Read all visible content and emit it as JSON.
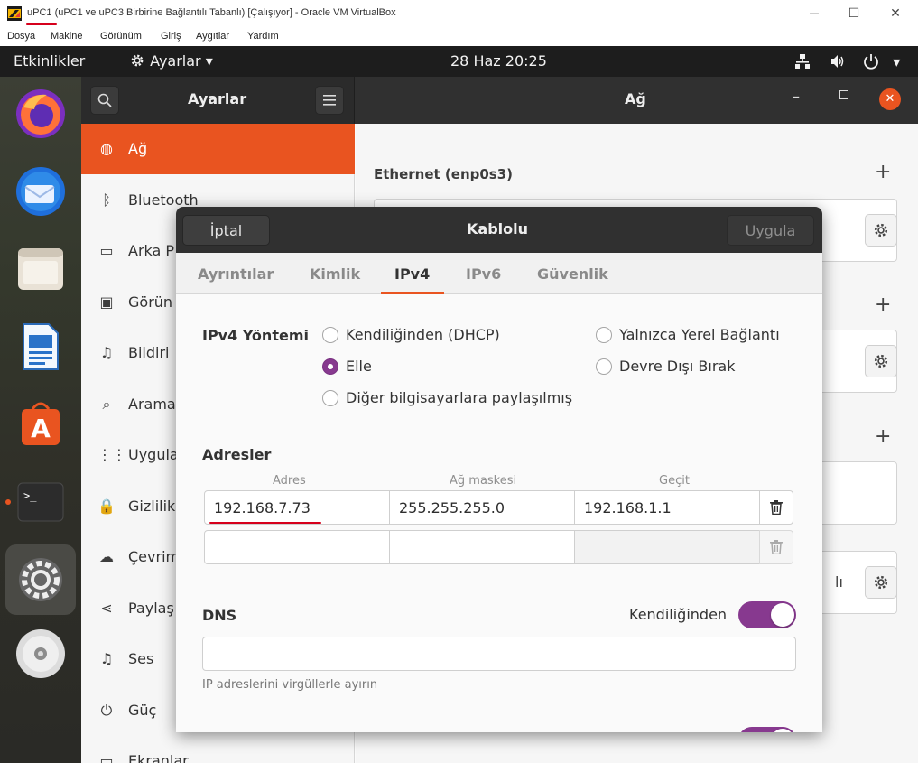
{
  "host": {
    "title": "uPC1 (uPC1 ve uPC3 Birbirine Bağlantılı Tabanlı) [Çalışıyor] - Oracle VM VirtualBox",
    "controls": {
      "minimize": "—",
      "maximize": "☐",
      "close": "✕"
    },
    "menu": [
      "Dosya",
      "Makine",
      "Görünüm",
      "Giriş",
      "Aygıtlar",
      "Yardım"
    ]
  },
  "topbar": {
    "activities": "Etkinlikler",
    "app_menu": "Ayarlar",
    "app_menu_arrow": "▾",
    "datetime": "28 Haz  20:25",
    "tray_arrow": "▾"
  },
  "settings": {
    "sidebar_title": "Ayarlar",
    "panel_title": "Ağ",
    "sidebar_items": [
      {
        "label": "Ağ",
        "icon": "globe-icon",
        "glyph": "◍"
      },
      {
        "label": "Bluetooth",
        "icon": "bluetooth-icon",
        "glyph": "ᛒ"
      },
      {
        "label": "Arka P",
        "icon": "background-icon",
        "glyph": "▭"
      },
      {
        "label": "Görün",
        "icon": "appearance-icon",
        "glyph": "▣"
      },
      {
        "label": "Bildiri",
        "icon": "bell-icon",
        "glyph": "♫"
      },
      {
        "label": "Arama",
        "icon": "search-icon",
        "glyph": "⌕"
      },
      {
        "label": "Uygula",
        "icon": "apps-grid-icon",
        "glyph": "⋮⋮"
      },
      {
        "label": "Gizlilik",
        "icon": "lock-icon",
        "glyph": "🔒"
      },
      {
        "label": "Çevrim",
        "icon": "cloud-icon",
        "glyph": "☁"
      },
      {
        "label": "Paylaş",
        "icon": "share-icon",
        "glyph": "⋖"
      },
      {
        "label": "Ses",
        "icon": "music-note-icon",
        "glyph": "♫"
      },
      {
        "label": "Güç",
        "icon": "power-icon",
        "glyph": "⏻"
      },
      {
        "label": "Ekranlar",
        "icon": "display-icon",
        "glyph": "▭"
      }
    ],
    "ethernet_title": "Ethernet (enp0s3)",
    "plus": "+",
    "partial_label": "lı"
  },
  "dialog": {
    "cancel": "İptal",
    "title": "Kablolu",
    "apply": "Uygula",
    "tabs": [
      "Ayrıntılar",
      "Kimlik",
      "IPv4",
      "IPv6",
      "Güvenlik"
    ],
    "active_tab": "IPv4",
    "method_label": "IPv4 Yöntemi",
    "methods": {
      "auto": "Kendiliğinden (DHCP)",
      "manual": "Elle",
      "shared": "Diğer bilgisayarlara paylaşılmış",
      "link_local": "Yalnızca Yerel Bağlantı",
      "disabled": "Devre Dışı Bırak"
    },
    "selected_method": "manual",
    "addresses_label": "Adresler",
    "columns": [
      "Adres",
      "Ağ maskesi",
      "Geçit"
    ],
    "rows": [
      {
        "address": "192.168.7.73",
        "netmask": "255.255.255.0",
        "gateway": "192.168.1.1"
      },
      {
        "address": "",
        "netmask": "",
        "gateway": ""
      }
    ],
    "dns_label": "DNS",
    "dns_auto_label": "Kendiliğinden",
    "dns_auto_on": true,
    "dns_value": "",
    "dns_hint": "IP adreslerini virgüllerle ayırın"
  },
  "colors": {
    "accent": "#e95420",
    "switch_on": "#87398f",
    "annotation_red": "#d6001c"
  }
}
